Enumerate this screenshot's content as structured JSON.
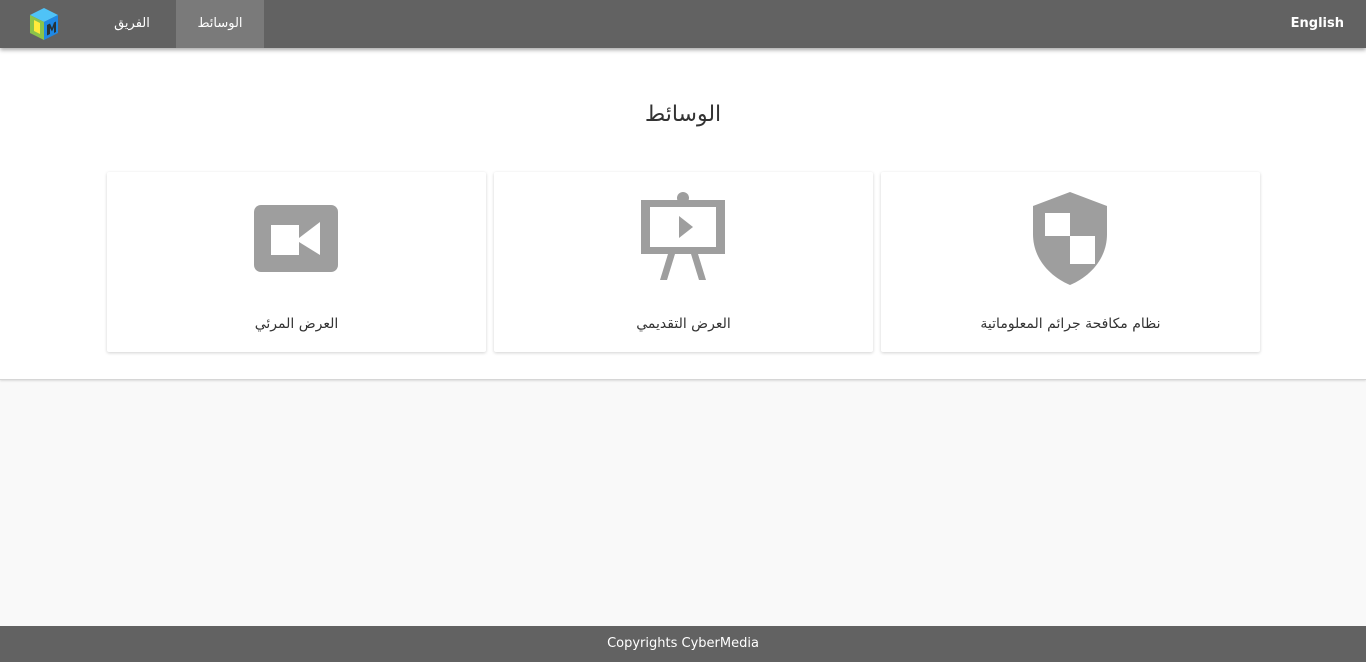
{
  "nav": {
    "items": [
      {
        "label": "الفريق"
      },
      {
        "label": "الوسائط",
        "active": true
      }
    ],
    "language_label": "English"
  },
  "main": {
    "title": "الوسائط",
    "cards": [
      {
        "label": "العرض المرئي",
        "icon": "video-camera-icon"
      },
      {
        "label": "العرض التقديمي",
        "icon": "presentation-board-icon"
      },
      {
        "label": "نظام مكافحة جرائم المعلوماتية",
        "icon": "shield-icon"
      }
    ]
  },
  "footer": {
    "text": "Copyrights CyberMedia"
  },
  "colors": {
    "navbar": "#626262",
    "nav_active": "#7a7a7a",
    "icon_gray": "#9e9e9e",
    "page_bg": "#f9f9f9"
  }
}
